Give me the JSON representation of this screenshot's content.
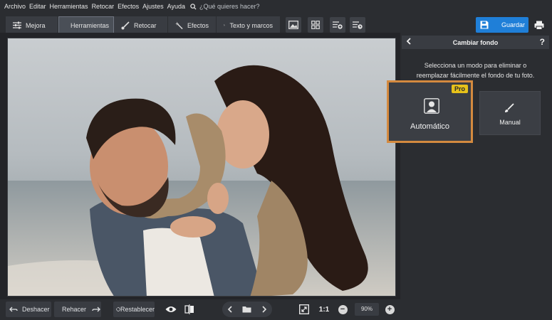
{
  "menu": {
    "items": [
      "Archivo",
      "Editar",
      "Herramientas",
      "Retocar",
      "Efectos",
      "Ajustes",
      "Ayuda"
    ],
    "search_placeholder": "¿Qué quieres hacer?"
  },
  "toolbar": {
    "tabs": [
      {
        "label": "Mejora",
        "icon": "sliders-icon"
      },
      {
        "label": "Herramientas",
        "icon": "crop-icon",
        "active": true
      },
      {
        "label": "Retocar",
        "icon": "brush-icon"
      },
      {
        "label": "Efectos",
        "icon": "magic-wand-icon"
      },
      {
        "label": "Texto y marcos",
        "icon": "text-icon"
      }
    ],
    "save_label": "Guardar"
  },
  "panel": {
    "title": "Cambiar fondo",
    "description_line1": "Selecciona un modo para eliminar o",
    "description_line2": "reemplazar fácilmente el fondo de tu foto.",
    "modes": [
      {
        "label": "Automático",
        "badge": "Pro",
        "selected": true
      },
      {
        "label": "Manual"
      }
    ]
  },
  "bottom": {
    "undo_label": "Deshacer",
    "redo_label": "Rehacer",
    "reset_label": "Restablecer",
    "one_to_one": "1:1",
    "zoom": "90%"
  },
  "colors": {
    "accent_blue": "#1f7fd8",
    "selected_border": "#d48a3f",
    "pro_badge": "#e7c21a",
    "background": "#2b2d31"
  }
}
